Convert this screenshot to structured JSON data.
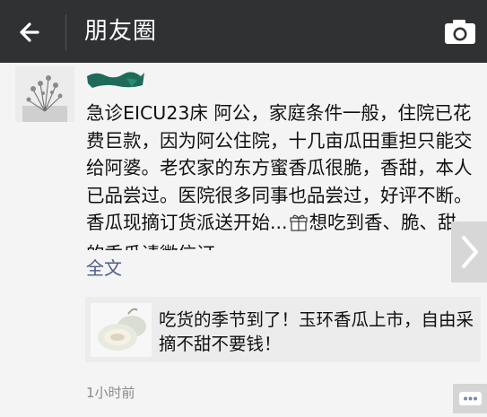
{
  "header": {
    "title": "朋友圈",
    "back_icon": "back-arrow-icon",
    "camera_icon": "camera-icon",
    "background_color": "#2f3132"
  },
  "post": {
    "text_before_icon": "急诊EICU23床 阿公，家庭条件一般，住院已花费巨款，因为阿公住院，十几亩瓜田重担只能交给阿婆。老农家的东方蜜香瓜很脆，香甜，本人已品尝过。医院很多同事也品尝过，好评不断。香瓜现摘订货派送开始...",
    "inline_icon": "gift-icon",
    "text_after_icon": "想吃到香、脆、甜的香瓜请微信订",
    "full_text_label": "全文",
    "link": {
      "title": "吃货的季节到了！玉环香瓜上市，自由采摘不甜不要钱！",
      "thumbnail_icon": "melon-thumbnail"
    },
    "timestamp": "1小时前",
    "comment_icon": "comment-icon"
  },
  "colors": {
    "link_blue": "#4f5d86",
    "name_green": "#1f6b5a",
    "page_bg": "#f4f4f4"
  }
}
